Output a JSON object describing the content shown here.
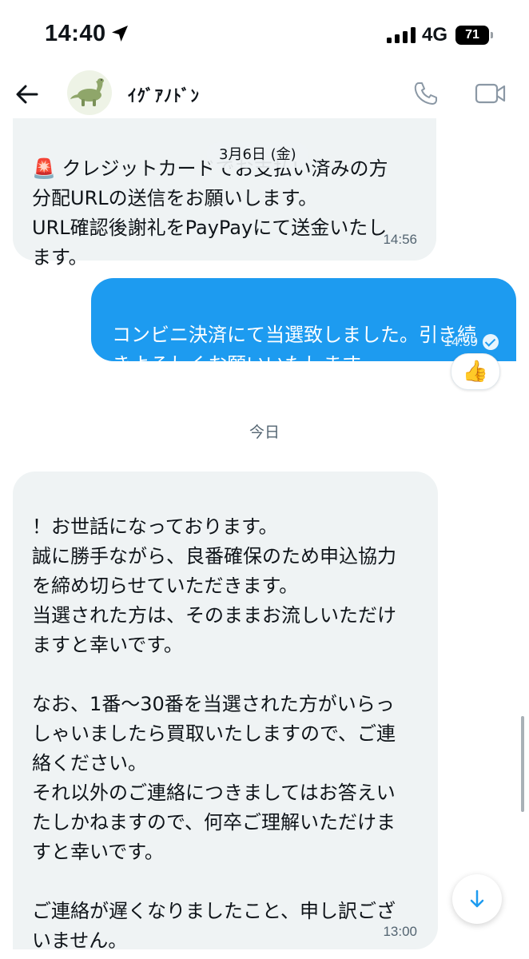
{
  "status_bar": {
    "time": "14:40",
    "network": "4G",
    "battery": "71"
  },
  "header": {
    "contact_name": "ｲｸﾞｱﾉﾄﾞﾝ",
    "back_icon": "arrow-left-icon",
    "call_icon": "phone-icon",
    "video_icon": "video-camera-icon",
    "avatar_icon": "dinosaur-avatar"
  },
  "messages": [
    {
      "direction": "incoming",
      "emoji": "🚨",
      "text": " クレジットカードでお支払い済みの方\n分配URLの送信をお願いします。\nURL確認後謝礼をPayPayにて送金いたし\nます。",
      "time": "14:56"
    },
    {
      "direction": "outgoing",
      "text": "コンビニ決済にて当選致しました。引き続\nきよろしくお願いいたします",
      "time": "14:59",
      "reaction": "👍"
    },
    {
      "direction": "incoming",
      "text": "！お世話になっております。\n誠に勝手ながら、良番確保のため申込協力\nを締め切らせていただきます。\n当選された方は、そのままお流しいただけ\nますと幸いです。\n\nなお、1番〜30番を当選された方がいらっ\nしゃいましたら買取いたしますので、ご連\n絡ください。\nそれ以外のご連絡につきましてはお答えい\nたしかねますので、何卒ご理解いただけま\nすと幸いです。\n\nご連絡が遅くなりましたこと、申し訳ござ\nいません。",
      "time": "13:00"
    }
  ],
  "date_chip": "3月6日 (金)",
  "day_separator": "今日",
  "colors": {
    "outgoing_bubble": "#1d9bf0",
    "incoming_bubble": "#eff3f4",
    "text": "#0f1419",
    "muted": "#536471"
  }
}
